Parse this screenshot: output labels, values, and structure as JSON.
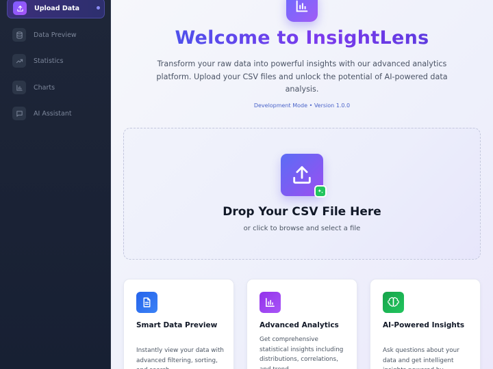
{
  "sidebar": {
    "items": [
      {
        "label": "Upload Data",
        "icon": "upload-icon",
        "active": true
      },
      {
        "label": "Data Preview",
        "icon": "database-icon",
        "active": false
      },
      {
        "label": "Statistics",
        "icon": "trending-up-icon",
        "active": false
      },
      {
        "label": "Charts",
        "icon": "bar-chart-icon",
        "active": false
      },
      {
        "label": "AI Assistant",
        "icon": "message-icon",
        "active": false
      }
    ]
  },
  "hero": {
    "icon": "bar-chart-icon",
    "title": "Welcome to InsightLens",
    "subtitle": "Transform your raw data into powerful insights with our advanced analytics platform. Upload your CSV files and unlock the potential of AI-powered data analysis.",
    "meta": "Development Mode • Version 1.0.0"
  },
  "dropzone": {
    "icon": "upload-icon",
    "badge_icon": "sparkles-icon",
    "title": "Drop Your CSV File Here",
    "subtitle": "or click to browse and select a file"
  },
  "features": [
    {
      "icon": "file-text-icon",
      "color": "#2563eb",
      "title": "Smart Data Preview",
      "description": "Instantly view your data with advanced filtering, sorting, and search"
    },
    {
      "icon": "bar-chart-icon",
      "color": "#9333ea",
      "title": "Advanced Analytics",
      "description": "Get comprehensive statistical insights including distributions, correlations, and trend"
    },
    {
      "icon": "brain-icon",
      "color": "#16a34a",
      "title": "AI-Powered Insights",
      "description": "Ask questions about your data and get intelligent insights powered by"
    }
  ],
  "colors": {
    "accent": "#7c3aed",
    "sidebar_bg": "#1e2638",
    "green": "#22c55e"
  }
}
